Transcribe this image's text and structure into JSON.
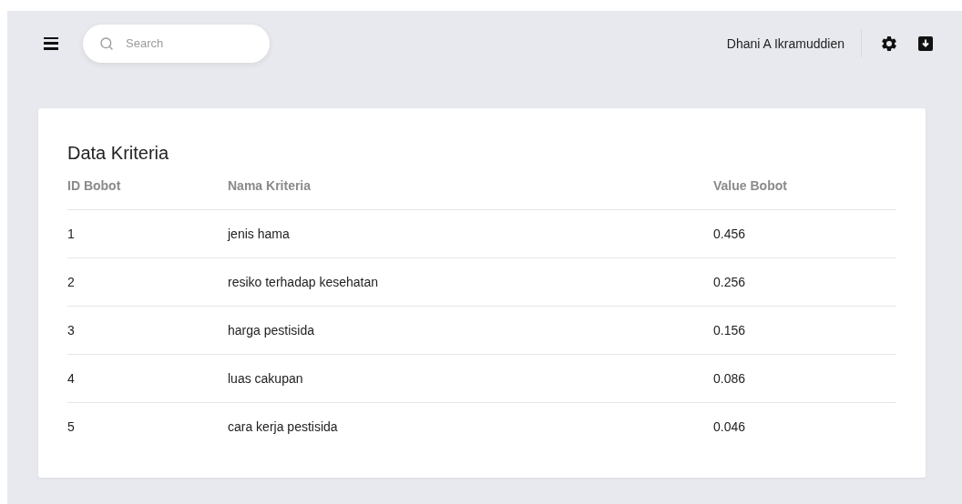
{
  "search": {
    "placeholder": "Search"
  },
  "user": {
    "name": "Dhani A Ikramuddien"
  },
  "card": {
    "title": "Data Kriteria"
  },
  "table": {
    "columns": [
      "ID Bobot",
      "Nama Kriteria",
      "Value Bobot"
    ],
    "rows": [
      [
        "1",
        "jenis hama",
        "0.456"
      ],
      [
        "2",
        "resiko terhadap kesehatan",
        "0.256"
      ],
      [
        "3",
        "harga pestisida",
        "0.156"
      ],
      [
        "4",
        "luas cakupan",
        "0.086"
      ],
      [
        "5",
        "cara kerja pestisida",
        "0.046"
      ]
    ]
  }
}
